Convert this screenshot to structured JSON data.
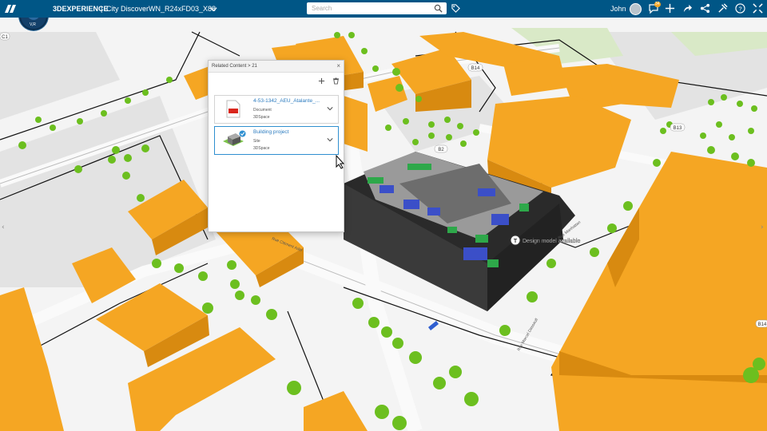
{
  "topbar": {
    "compass_labels": [
      "3D",
      "V,R"
    ],
    "brand": "3DEXPERIENCE",
    "separator": "|",
    "app_name": "City Discover",
    "doc_title": "WN_R24xFD03_X88",
    "search_placeholder": "Search",
    "user_name": "John",
    "notification_count": "34"
  },
  "panel": {
    "title": "Related Content > 21",
    "items": [
      {
        "name": "4-53-1342_AEU_Atalante_...",
        "type": "Document",
        "source": "3DSpace"
      },
      {
        "name": "Building project",
        "type": "Site",
        "source": "3DSpace"
      }
    ]
  },
  "map": {
    "road_labels": [
      "C1",
      "B14",
      "B13",
      "B2",
      "B14"
    ],
    "street_name": "Rue Clément Ader",
    "street_name_2": "Rue Manhattan",
    "street_name_3": "Rue Marcel Dassault",
    "tooltip": "Design model available",
    "tooltip_icon_letter": "T"
  },
  "colors": {
    "topbar": "#005686",
    "building": "#f5a623",
    "tree": "#6cbf1f",
    "selection": "#2f8fd0",
    "link": "#2b7bbf"
  },
  "icons": [
    "ds-logo-icon",
    "compass-icon",
    "chevron-down-icon",
    "search-icon",
    "tag-icon",
    "avatar",
    "chat-icon",
    "plus-icon",
    "share-icon",
    "network-icon",
    "tools-icon",
    "help-icon",
    "collapse-icon",
    "close-icon",
    "trash-icon",
    "pdf-icon",
    "site-icon",
    "check-icon",
    "cursor-icon"
  ]
}
